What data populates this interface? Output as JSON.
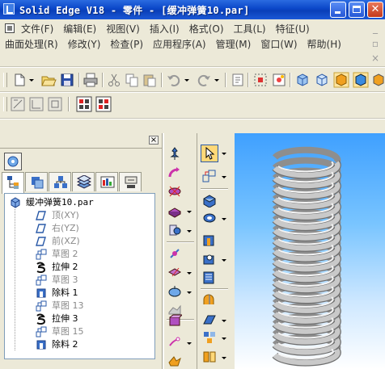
{
  "window": {
    "title": "Solid Edge V18 - 零件 - [缓冲弹簧10.par]"
  },
  "menus": {
    "row1": [
      "文件(F)",
      "编辑(E)",
      "视图(V)",
      "插入(I)",
      "格式(O)",
      "工具(L)",
      "特征(U)"
    ],
    "row2": [
      "曲面处理(R)",
      "修改(Y)",
      "检查(P)",
      "应用程序(A)",
      "管理(M)",
      "窗口(W)",
      "帮助(H)"
    ]
  },
  "pathfinder": {
    "root": "缓冲弹簧10.par",
    "items": [
      {
        "label": "顶(XY)",
        "dim": true,
        "icon": "reference-plane-icon"
      },
      {
        "label": "右(YZ)",
        "dim": true,
        "icon": "reference-plane-icon"
      },
      {
        "label": "前(XZ)",
        "dim": true,
        "icon": "reference-plane-icon"
      },
      {
        "label": "草图 2",
        "dim": true,
        "icon": "sketch-icon"
      },
      {
        "label": "拉伸 2",
        "dim": false,
        "icon": "extrude-icon"
      },
      {
        "label": "草图 3",
        "dim": true,
        "icon": "sketch-icon"
      },
      {
        "label": "除料 1",
        "dim": false,
        "icon": "cutout-icon"
      },
      {
        "label": "草图 13",
        "dim": true,
        "icon": "sketch-icon"
      },
      {
        "label": "拉伸 3",
        "dim": false,
        "icon": "extrude-icon"
      },
      {
        "label": "草图 15",
        "dim": true,
        "icon": "sketch-icon"
      },
      {
        "label": "除料 2",
        "dim": false,
        "icon": "cutout-icon"
      }
    ]
  },
  "colors": {
    "titlebar": "#0a46c8",
    "viewport_top": "#3fa0ff",
    "viewport_bottom": "#ffffff",
    "spring": "#c9c9c9"
  }
}
